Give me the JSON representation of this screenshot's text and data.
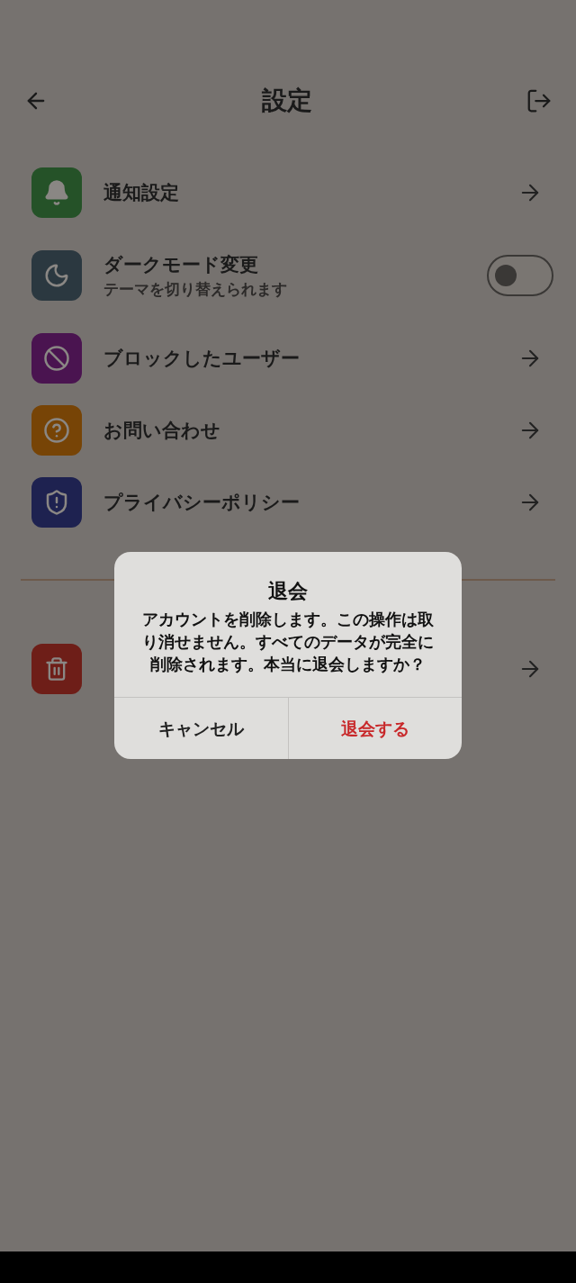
{
  "header": {
    "title": "設定"
  },
  "items": [
    {
      "kind": "link",
      "title": "通知設定",
      "color": "#255228"
    },
    {
      "kind": "toggle",
      "title": "ダークモード変更",
      "subtitle": "テーマを切り替えられます",
      "color": "#2b3840",
      "on": false
    },
    {
      "kind": "link",
      "title": "ブロックしたユーザー",
      "color": "#4a1450"
    },
    {
      "kind": "link",
      "title": "お問い合わせ",
      "color": "#774406"
    },
    {
      "kind": "link",
      "title": "プライバシーポリシー",
      "color": "#1e2250"
    }
  ],
  "danger_item": {
    "kind": "link",
    "color": "#6e1e18"
  },
  "dialog": {
    "title": "退会",
    "message": "アカウントを削除します。この操作は取り消せません。すべてのデータが完全に削除されます。本当に退会しますか？",
    "buttons": [
      {
        "label": "キャンセル",
        "kind": "cancel"
      },
      {
        "label": "退会する",
        "kind": "destructive"
      }
    ]
  }
}
